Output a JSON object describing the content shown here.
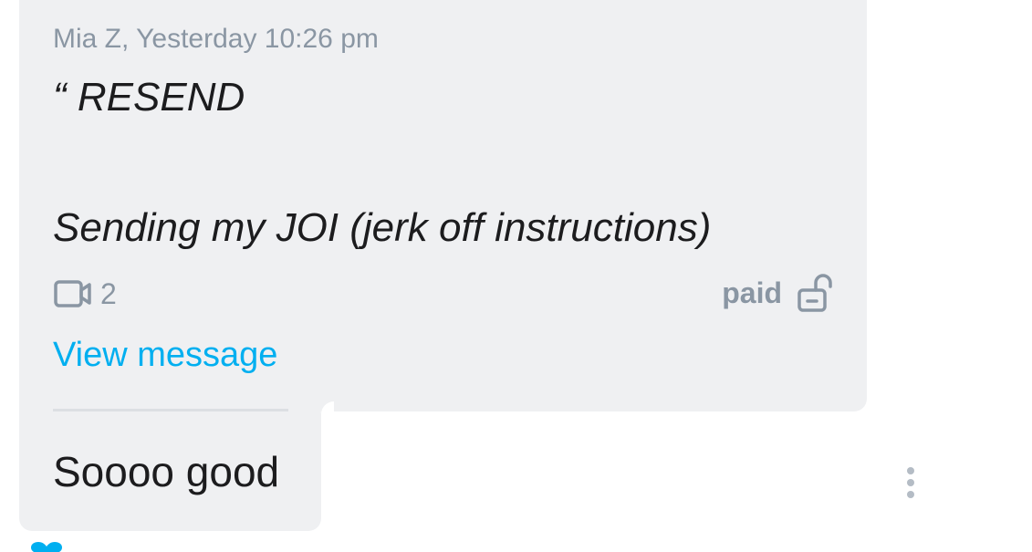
{
  "message": {
    "meta": "Mia Z, Yesterday 10:26 pm",
    "quote_line_1": "“ RESEND",
    "quote_line_2": "Sending my JOI (jerk off instructions)",
    "media": {
      "icon": "video-camera-icon",
      "count": "2"
    },
    "price_status": {
      "label": "paid",
      "icon": "unlock-icon"
    },
    "view_link": "View message"
  },
  "reply": {
    "text": "Soooo good"
  },
  "colors": {
    "bubble_bg": "#eff0f2",
    "link": "#00aff0",
    "muted": "#8a96a3",
    "text": "#1c1c1e",
    "heart": "#00aff0"
  },
  "icons": {
    "more": "more-vertical-icon",
    "reaction": "heart-icon"
  }
}
